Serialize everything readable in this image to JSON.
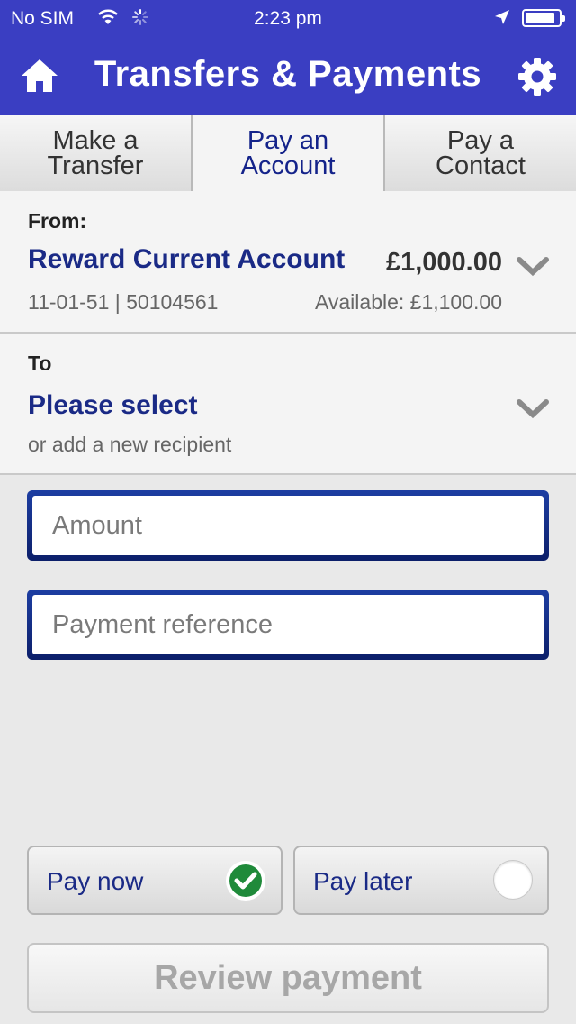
{
  "status_bar": {
    "carrier": "No SIM",
    "time": "2:23 pm",
    "wifi_icon": "wifi-icon",
    "activity_icon": "activity-spinner-icon",
    "location_icon": "location-arrow-icon",
    "battery_level": 0.9
  },
  "header": {
    "title": "Transfers & Payments",
    "home_icon": "home-icon",
    "settings_icon": "gear-icon",
    "background_color": "#3a3ec2"
  },
  "tabs": [
    {
      "label": "Make a\nTransfer",
      "active": false
    },
    {
      "label": "Pay an\nAccount",
      "active": true
    },
    {
      "label": "Pay a\nContact",
      "active": false
    }
  ],
  "from": {
    "label": "From:",
    "account_name": "Reward Current Account",
    "balance": "£1,000.00",
    "sort_and_number": "11-01-51 | 50104561",
    "available": "Available: £1,100.00"
  },
  "to": {
    "label": "To",
    "select_text": "Please select",
    "sub_text": "or add a new recipient"
  },
  "inputs": {
    "amount_placeholder": "Amount",
    "amount_value": "",
    "reference_placeholder": "Payment reference",
    "reference_value": ""
  },
  "timing": {
    "pay_now_label": "Pay now",
    "pay_later_label": "Pay later",
    "selected": "pay_now",
    "check_color": "#1f8a3a"
  },
  "actions": {
    "review_label": "Review payment"
  },
  "colors": {
    "brand_blue": "#3a3ec2",
    "link_navy": "#1a2a86"
  }
}
